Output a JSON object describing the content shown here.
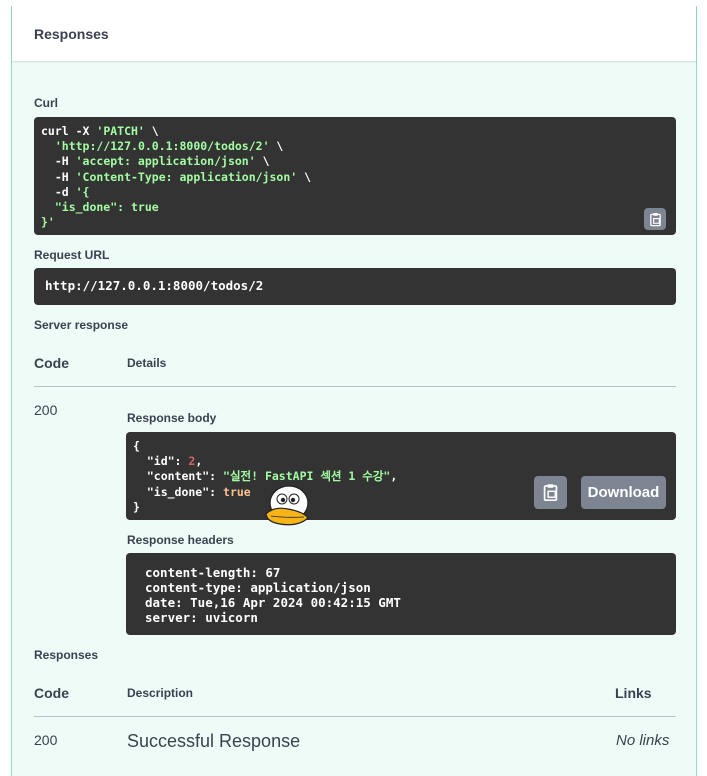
{
  "responses_section": {
    "title": "Responses"
  },
  "curl": {
    "label": "Curl",
    "lines": [
      [
        "curl -X ",
        "'PATCH'",
        " \\"
      ],
      [
        "  ",
        "'http://127.0.0.1:8000/todos/2'",
        " \\"
      ],
      [
        "  -H ",
        "'accept: application/json'",
        " \\"
      ],
      [
        "  -H ",
        "'Content-Type: application/json'",
        " \\"
      ],
      [
        "  -d ",
        "'{",
        ""
      ],
      [
        "  \"is_done\": true",
        "",
        ""
      ],
      [
        "",
        "}'",
        ""
      ]
    ]
  },
  "request_url": {
    "label": "Request URL",
    "value": "http://127.0.0.1:8000/todos/2"
  },
  "server_response": {
    "label": "Server response",
    "col_code": "Code",
    "col_details": "Details",
    "code": "200",
    "body_label": "Response body",
    "body": {
      "open": "{",
      "id_key": "  \"id\": ",
      "id_val": "2",
      "content_key": "  \"content\": ",
      "content_val": "\"실전! FastAPI 섹션 1 수강\"",
      "done_key": "  \"is_done\": ",
      "done_val": "true",
      "close": "}"
    },
    "download_label": "Download",
    "headers_label": "Response headers",
    "headers": [
      "content-length: 67",
      "content-type: application/json",
      "date: Tue,16 Apr 2024 00:42:15 GMT",
      "server: uvicorn"
    ]
  },
  "responses_table": {
    "label": "Responses",
    "col_code": "Code",
    "col_description": "Description",
    "col_links": "Links",
    "rows": [
      {
        "code": "200",
        "description": "Successful Response",
        "links": "No links"
      }
    ]
  },
  "icons": [
    "clipboard-icon",
    "duck-sticker-icon"
  ],
  "colors": {
    "panel_bg": "#eefbf6",
    "panel_border": "#8fe0c4",
    "code_bg": "#333333",
    "string": "#a2fca2",
    "button": "#7d8492"
  }
}
